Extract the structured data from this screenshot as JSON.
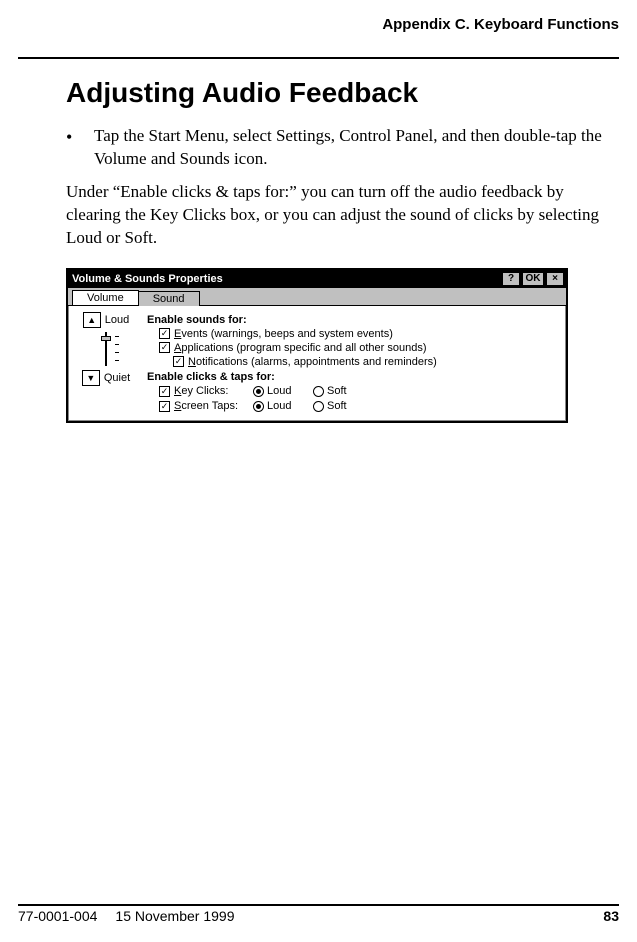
{
  "header": {
    "appendix": "Appendix C. Keyboard Functions"
  },
  "section": {
    "title": "Adjusting Audio Feedback",
    "bullet_text": "Tap the Start Menu, select Settings, Control Panel, and then double-tap the Volume and Sounds icon.",
    "paragraph": "Under “Enable clicks & taps for:” you can turn off the audio feedback by clearing the Key Clicks box, or you can adjust the sound of clicks by selecting Loud or Soft."
  },
  "dialog": {
    "title": "Volume & Sounds Properties",
    "help": "?",
    "ok": "OK",
    "close": "×",
    "tabs": {
      "volume": "Volume",
      "sound": "Sound"
    },
    "volume": {
      "loud": "Loud",
      "quiet": "Quiet",
      "up": "▲",
      "down": "▼"
    },
    "sounds": {
      "header": "Enable sounds for:",
      "events_u": "E",
      "events_rest": "vents (warnings, beeps and system events)",
      "apps_u": "A",
      "apps_rest": "pplications (program specific and all other sounds)",
      "notif_u": "N",
      "notif_rest": "otifications (alarms, appointments and reminders)"
    },
    "clicks": {
      "header": "Enable clicks & taps for:",
      "key_u": "K",
      "key_rest": "ey Clicks:",
      "screen_u": "S",
      "screen_rest": "creen Taps:",
      "loud": "Loud",
      "soft": "Soft"
    }
  },
  "footer": {
    "docnum": "77-0001-004",
    "date": "15 November 1999",
    "page": "83"
  }
}
